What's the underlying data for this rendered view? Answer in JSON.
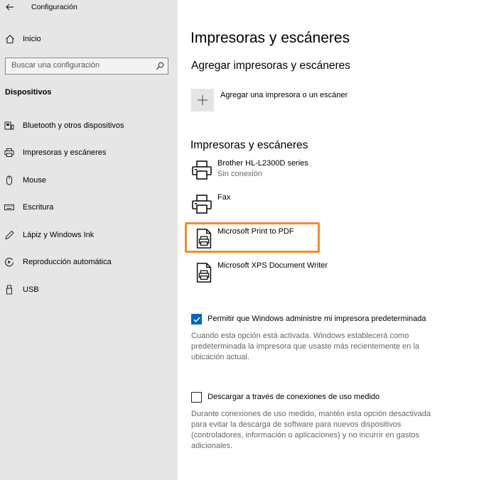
{
  "window": {
    "title": "Configuración"
  },
  "sidebar": {
    "home_label": "Inicio",
    "search_placeholder": "Buscar una configuración",
    "section_title": "Dispositivos",
    "items": [
      {
        "label": "Bluetooth y otros dispositivos",
        "icon": "bluetooth-devices-icon"
      },
      {
        "label": "Impresoras y escáneres",
        "icon": "printer-icon"
      },
      {
        "label": "Mouse",
        "icon": "mouse-icon"
      },
      {
        "label": "Escritura",
        "icon": "keyboard-icon"
      },
      {
        "label": "Lápiz y Windows Ink",
        "icon": "pen-icon"
      },
      {
        "label": "Reproducción automática",
        "icon": "autoplay-icon"
      },
      {
        "label": "USB",
        "icon": "usb-icon"
      }
    ]
  },
  "main": {
    "title": "Impresoras y escáneres",
    "add_section_title": "Agregar impresoras y escáneres",
    "add_button_label": "Agregar una impresora o un escáner",
    "list_section_title": "Impresoras y escáneres",
    "printers": [
      {
        "name": "Brother HL-L2300D series",
        "status": "Sin conexión",
        "icon": "printer-icon"
      },
      {
        "name": "Fax",
        "status": "",
        "icon": "fax-printer-icon"
      },
      {
        "name": "Microsoft Print to PDF",
        "status": "",
        "icon": "document-printer-icon"
      },
      {
        "name": "Microsoft XPS Document Writer",
        "status": "",
        "icon": "document-printer-icon"
      }
    ],
    "default_printer": {
      "checked": true,
      "label": "Permitir que Windows administre mi impresora predeterminada",
      "description": "Cuando esta opción está activada. Windows establecerá como predeterminada la impresora que usaste más recientemente en la ubicación actual."
    },
    "metered": {
      "checked": false,
      "label": "Descargar a través de conexiones de uso medido",
      "description": "Durante conexiones de uso medido, mantén esta opción desactivada para evitar la descarga de software para nuevos dispositivos (controladores, información o aplicaciones) y no incurrir en gastos adicionales."
    }
  },
  "colors": {
    "highlight": "#f28c28",
    "accent": "#0067c0",
    "sidebar_bg": "#e6e6e6"
  }
}
